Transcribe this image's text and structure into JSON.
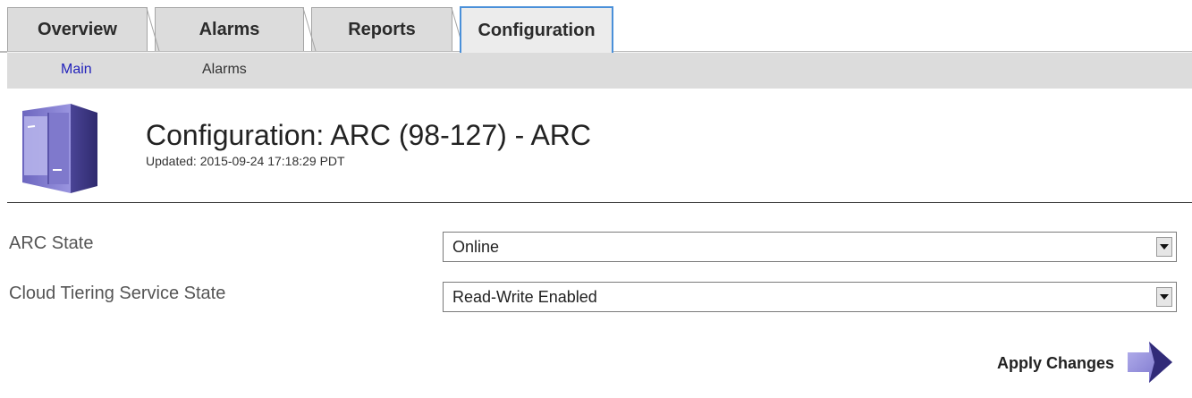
{
  "tabs": [
    {
      "label": "Overview",
      "active": false
    },
    {
      "label": "Alarms",
      "active": false
    },
    {
      "label": "Reports",
      "active": false
    },
    {
      "label": "Configuration",
      "active": true
    }
  ],
  "subnav": [
    {
      "label": "Main",
      "active": true
    },
    {
      "label": "Alarms",
      "active": false
    }
  ],
  "header": {
    "icon": "server-icon",
    "title": "Configuration: ARC (98-127) - ARC",
    "updated": "Updated: 2015-09-24 17:18:29 PDT"
  },
  "form": {
    "arc_state": {
      "label": "ARC State",
      "value": "Online"
    },
    "cloud_tiering": {
      "label": "Cloud Tiering Service State",
      "value": "Read-Write Enabled"
    }
  },
  "apply": {
    "label": "Apply Changes",
    "icon": "arrow-right-icon"
  },
  "colors": {
    "tab_bg": "#dcdcdc",
    "active_tab_border": "#4a90d9",
    "active_link": "#2222bb",
    "icon_purple": "#8f8ad6"
  }
}
